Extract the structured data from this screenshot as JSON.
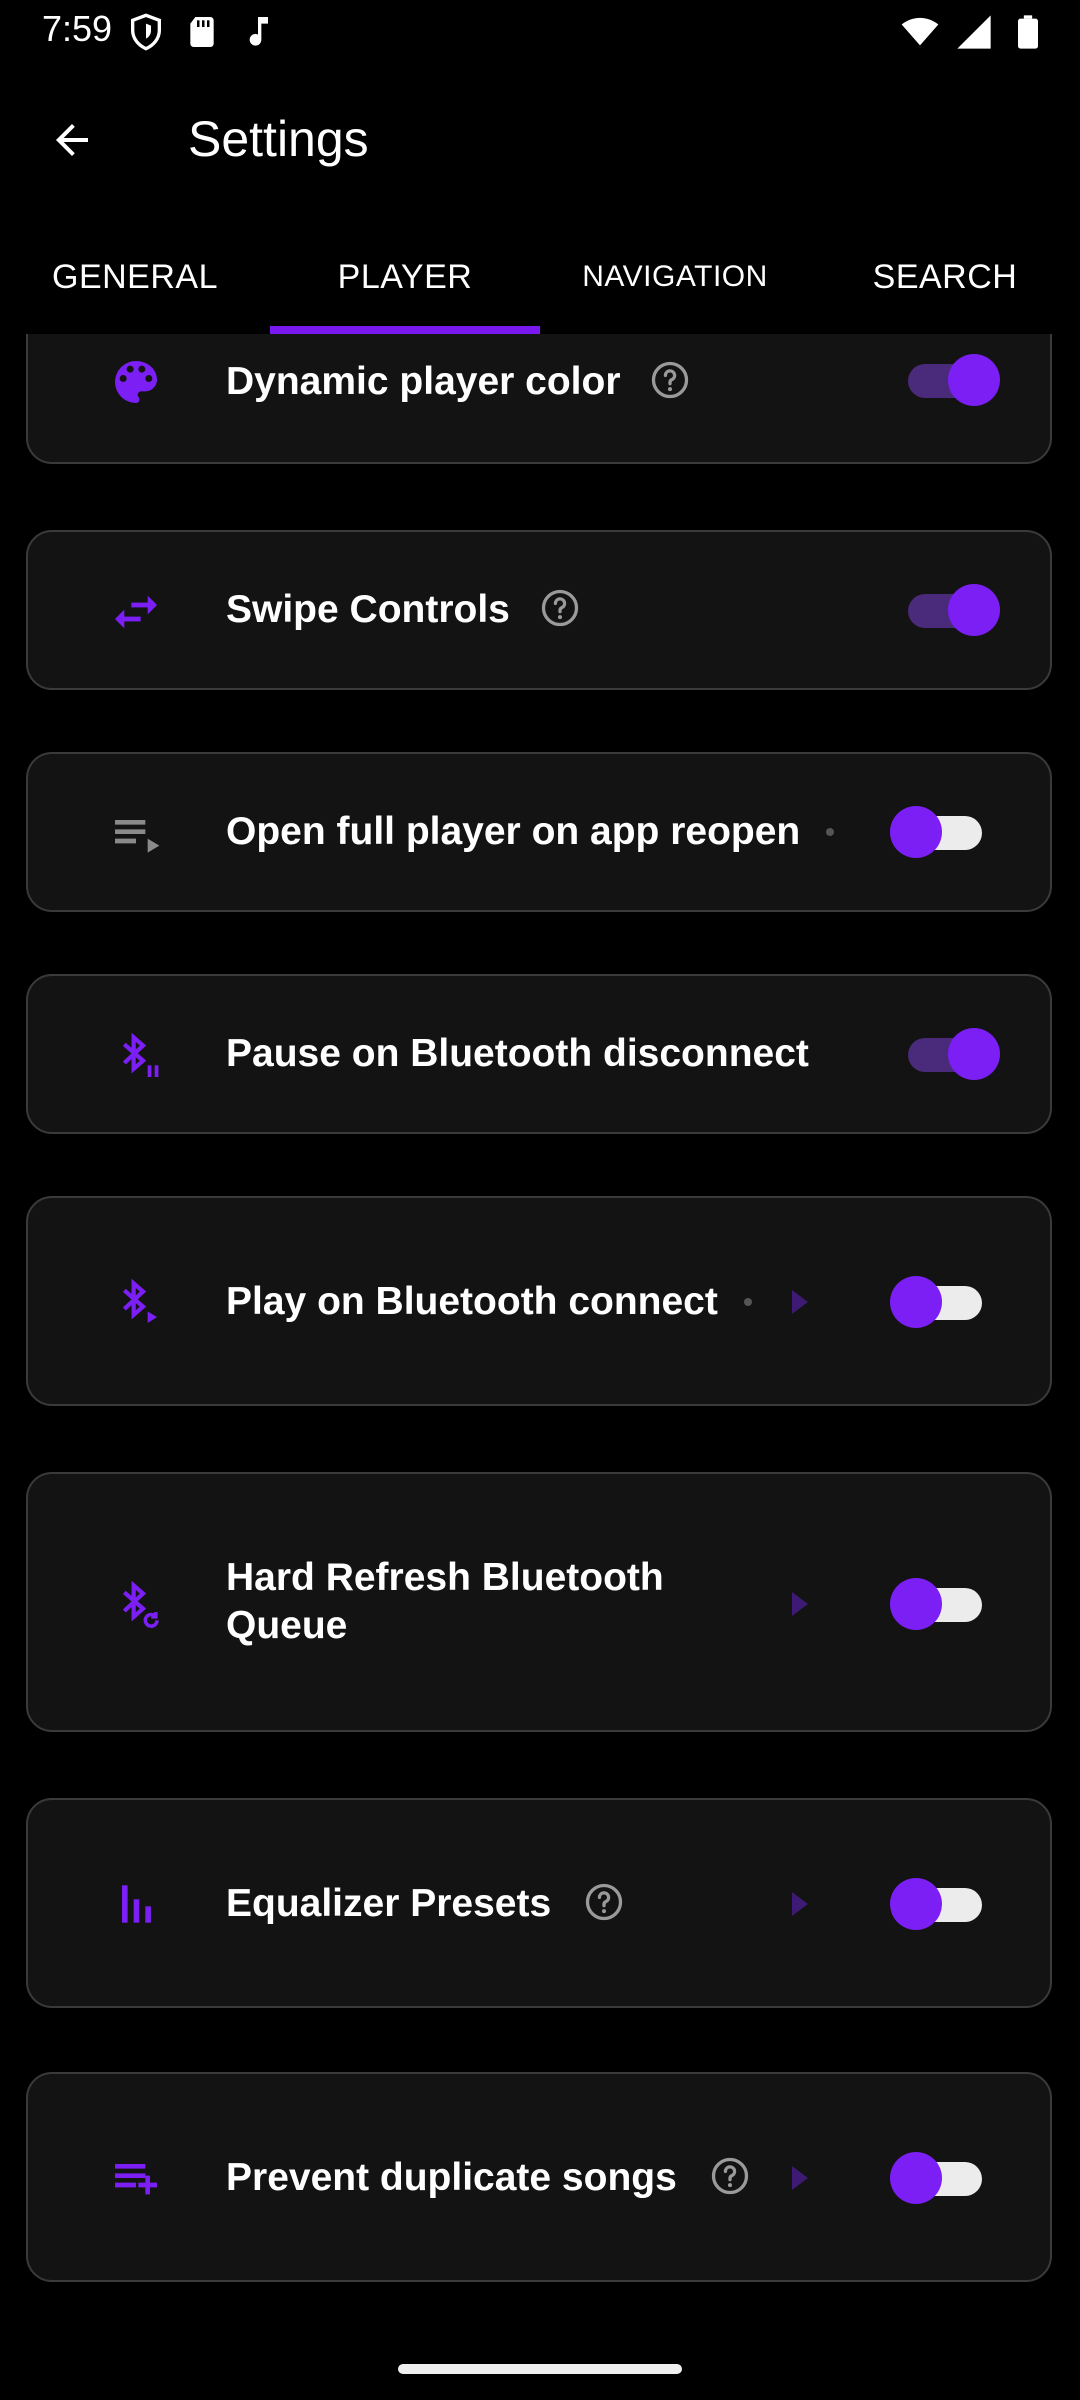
{
  "status_bar": {
    "time": "7:59",
    "left_icons": [
      "shield-icon",
      "sd-card-icon",
      "music-note-icon"
    ],
    "right_icons": [
      "wifi-icon",
      "signal-icon",
      "battery-icon"
    ]
  },
  "app_bar": {
    "title": "Settings",
    "back_icon": "arrow-left-icon"
  },
  "tabs": [
    {
      "label": "GENERAL",
      "selected": false
    },
    {
      "label": "PLAYER",
      "selected": true
    },
    {
      "label": "NAVIGATION",
      "selected": false
    },
    {
      "label": "SEARCH",
      "selected": false
    }
  ],
  "settings": [
    {
      "label": "Dynamic player color",
      "icon": "palette-icon",
      "has_help": true,
      "has_chevron": false,
      "toggle": "on"
    },
    {
      "label": "Swipe Controls",
      "icon": "swap-horizontal-icon",
      "has_help": true,
      "has_chevron": false,
      "toggle": "on"
    },
    {
      "label": "Open full player on app reopen",
      "icon": "queue-play-icon",
      "has_help": false,
      "has_chevron": false,
      "toggle": "off"
    },
    {
      "label": "Pause on Bluetooth disconnect",
      "icon": "bluetooth-pause-icon",
      "has_help": false,
      "has_chevron": false,
      "toggle": "on"
    },
    {
      "label": "Play on Bluetooth connect",
      "icon": "bluetooth-play-icon",
      "has_help": false,
      "has_chevron": true,
      "toggle": "off"
    },
    {
      "label": "Hard Refresh Bluetooth Queue",
      "label_line1": "Hard Refresh Bluetooth",
      "label_line2": "Queue",
      "icon": "bluetooth-refresh-icon",
      "has_help": false,
      "has_chevron": true,
      "toggle": "off"
    },
    {
      "label": "Equalizer Presets",
      "icon": "equalizer-icon",
      "has_help": true,
      "has_chevron": true,
      "toggle": "off"
    },
    {
      "label": "Prevent duplicate songs",
      "icon": "playlist-add-icon",
      "has_help": true,
      "has_chevron": true,
      "toggle": "off"
    }
  ],
  "colors": {
    "accent": "#7b1ff5",
    "card_bg": "#131313",
    "card_border": "#3a3a3a",
    "background": "#000000"
  }
}
